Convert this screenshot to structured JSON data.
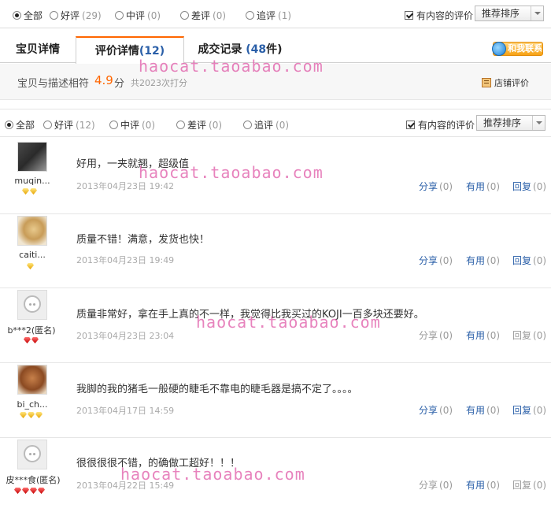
{
  "filters": [
    {
      "label": "全部",
      "count": "",
      "checked": true
    },
    {
      "label": "好评",
      "count": "(29)",
      "checked": false
    },
    {
      "label": "中评",
      "count": "(0)",
      "checked": false
    },
    {
      "label": "差评",
      "count": "(0)",
      "checked": false
    },
    {
      "label": "追评",
      "count": "(1)",
      "checked": false
    }
  ],
  "filters_mid": [
    {
      "label": "全部",
      "count": "",
      "checked": true
    },
    {
      "label": "好评",
      "count": "(12)",
      "checked": false
    },
    {
      "label": "中评",
      "count": "(0)",
      "checked": false
    },
    {
      "label": "差评",
      "count": "(0)",
      "checked": false
    },
    {
      "label": "追评",
      "count": "(0)",
      "checked": false
    }
  ],
  "content_only_label": "有内容的评价",
  "sort_label": "推荐排序",
  "tabs": [
    {
      "label": "宝贝详情",
      "num": "",
      "suffix": ""
    },
    {
      "label": "评价详情",
      "num": "(12)",
      "suffix": ""
    },
    {
      "label": "成交记录 ",
      "num": "(48",
      "suffix": "件)"
    }
  ],
  "contact_label": "和我联系",
  "rating": {
    "label": "宝贝与描述相符",
    "score": "4.9",
    "unit": "分",
    "count": "共2023次打分",
    "shop_label": "店铺评价"
  },
  "watermark": "haocat.taoabao.com",
  "reviews": [
    {
      "user": "muqin...",
      "text": "好用，一夹就翘，超级值",
      "date": "2013年04月23日 19:42",
      "badges": [
        "gold",
        "gold"
      ],
      "avatar": "girl",
      "share": "分享",
      "share_count": "(0)",
      "useful": "有用",
      "useful_count": "(0)",
      "reply": "回复",
      "reply_count": "(0)"
    },
    {
      "user": "caiti...",
      "text": "质量不错！满意，发货也快！",
      "date": "2013年04月23日 19:49",
      "badges": [
        "gold"
      ],
      "avatar": "blond",
      "share": "分享",
      "share_count": "(0)",
      "useful": "有用",
      "useful_count": "(0)",
      "reply": "回复",
      "reply_count": "(0)"
    },
    {
      "user": "b***2(匿名)",
      "text": "质量非常好，拿在手上真的不一样，我觉得比我买过的KOJI一百多块还要好。",
      "date": "2013年04月23日 23:04",
      "badges": [
        "red",
        "red"
      ],
      "avatar": "default",
      "share": "分享",
      "share_count": "(0)",
      "useful": "有用",
      "useful_count": "(0)",
      "reply": "回复",
      "reply_count": "(0)"
    },
    {
      "user": "bi_ch...",
      "text": "我脚的我的猪毛一般硬的睫毛不靠电的睫毛器是搞不定了。。。。",
      "date": "2013年04月17日 14:59",
      "badges": [
        "gold",
        "gold",
        "gold"
      ],
      "avatar": "dog",
      "share": "分享",
      "share_count": "(0)",
      "useful": "有用",
      "useful_count": "(0)",
      "reply": "回复",
      "reply_count": "(0)"
    },
    {
      "user": "皮***食(匿名)",
      "text": "很很很很不错，的确做工超好！！！",
      "date": "2013年04月22日 15:49",
      "badges": [
        "red",
        "red",
        "red",
        "red"
      ],
      "avatar": "default",
      "share": "分享",
      "share_count": "(0)",
      "useful": "有用",
      "useful_count": "(0)",
      "reply": "回复",
      "reply_count": "(0)"
    }
  ]
}
